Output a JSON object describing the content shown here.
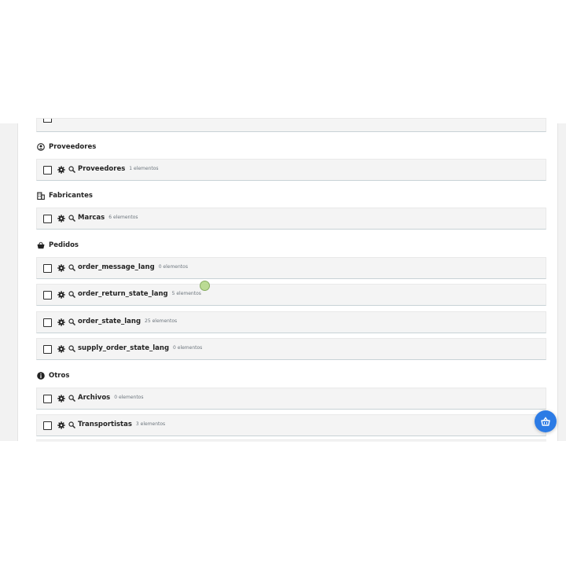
{
  "sections": {
    "suppliers": {
      "title": "Proveedores",
      "icon": "user-circle-icon",
      "rows": [
        {
          "name": "Proveedores",
          "count": "1 elementos"
        }
      ]
    },
    "manufacturers": {
      "title": "Fabricantes",
      "icon": "building-icon",
      "rows": [
        {
          "name": "Marcas",
          "count": "6 elementos"
        }
      ]
    },
    "orders": {
      "title": "Pedidos",
      "icon": "basket-icon",
      "rows": [
        {
          "name": "order_message_lang",
          "count": "0 elementos"
        },
        {
          "name": "order_return_state_lang",
          "count": "5 elementos"
        },
        {
          "name": "order_state_lang",
          "count": "25 elementos"
        },
        {
          "name": "supply_order_state_lang",
          "count": "0 elementos"
        }
      ]
    },
    "others": {
      "title": "Otros",
      "icon": "info-circle-icon",
      "rows": [
        {
          "name": "Archivos",
          "count": "0 elementos"
        },
        {
          "name": "Transportistas",
          "count": "3 elementos"
        }
      ]
    }
  },
  "row_icons": {
    "settings": "gear-icon",
    "search": "search-icon"
  },
  "floating_button": {
    "icon": "help-basket-icon",
    "color": "#2c7be5"
  },
  "colors": {
    "accent": "#2c7be5",
    "row_bg": "#f4f4f4",
    "cursor": "#b5d98a"
  }
}
